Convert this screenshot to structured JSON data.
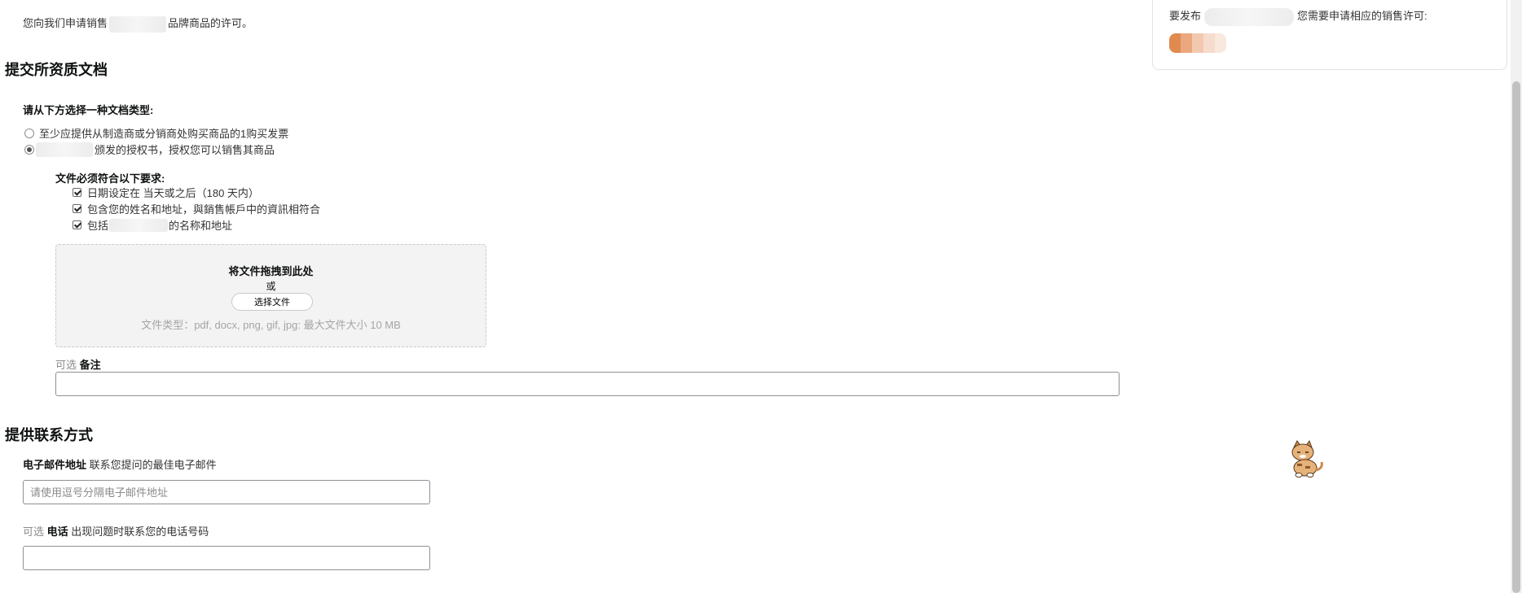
{
  "intro": {
    "prefix": "您向我们申请销售",
    "suffix": "品牌商品的许可。"
  },
  "documents_section": {
    "title": "提交所资质文档",
    "doc_type_label": "请从下方选择一种文档类型:",
    "options": [
      {
        "label": "至少应提供从制造商或分销商处购买商品的1购买发票",
        "selected": false
      },
      {
        "label": "颁发的授权书，授权您可以销售其商品",
        "selected": true
      }
    ],
    "requirements_title": "文件必须符合以下要求:",
    "requirements": [
      {
        "prefix": "日期设定在 当天或之后（180 天内）",
        "suffix": "",
        "checked": true
      },
      {
        "prefix": "包含您的姓名和地址，與銷售帳戶中的資訊相符合",
        "suffix": "",
        "checked": true
      },
      {
        "prefix": "包括",
        "suffix": "的名称和地址",
        "checked": true
      }
    ],
    "dropzone": {
      "title": "将文件拖拽到此处",
      "or": "或",
      "button": "选择文件",
      "hint": "文件类型：pdf, docx, png, gif, jpg: 最大文件大小 10 MB"
    },
    "notes": {
      "optional": "可选",
      "label": "备注",
      "value": ""
    }
  },
  "contact_section": {
    "title": "提供联系方式",
    "email": {
      "label": "电子邮件地址",
      "hint": "联系您提问的最佳电子邮件",
      "placeholder": "请使用逗号分隔电子邮件地址",
      "value": ""
    },
    "phone": {
      "optional": "可选",
      "label": "电话",
      "hint": "出现问题时联系您的电话号码",
      "value": ""
    }
  },
  "side_card": {
    "prefix": "要发布",
    "suffix": "您需要申请相应的销售许可:"
  },
  "colors": {
    "badge": [
      "#e08a50",
      "#eba77e",
      "#f2c9b0",
      "#f6dccc",
      "#f9e8dd"
    ]
  }
}
